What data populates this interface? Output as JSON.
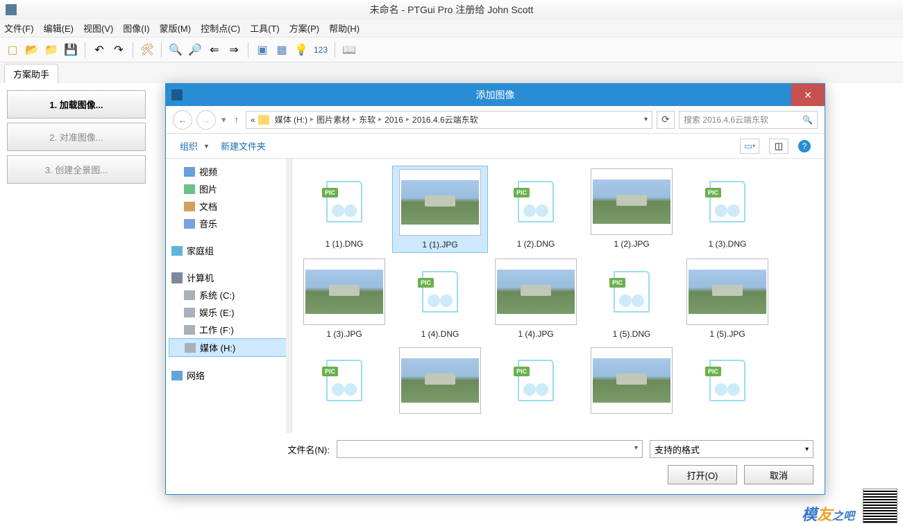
{
  "window": {
    "title": "未命名 - PTGui Pro 注册给 John Scott"
  },
  "menu": {
    "file": "文件(F)",
    "edit": "编辑(E)",
    "view": "视图(V)",
    "image": "图像(I)",
    "mask": "蒙版(M)",
    "ctrl": "控制点(C)",
    "tool": "工具(T)",
    "proj": "方案(P)",
    "help": "帮助(H)"
  },
  "toolbar": {
    "num": "123"
  },
  "tabs": {
    "wizard": "方案助手"
  },
  "wizard": {
    "b1": "1. 加载图像...",
    "b2": "2. 对准图像...",
    "b3": "3. 创建全景图..."
  },
  "dialog": {
    "title": "添加图像",
    "crumbs": {
      "pre": "«",
      "path1": "媒体 (H:)",
      "path2": "图片素材",
      "path3": "东软",
      "path4": "2016",
      "path5": "2016.4.6云端东软"
    },
    "search_placeholder": "搜索 2016.4.6云端东软",
    "organize": "组织",
    "newfolder": "新建文件夹",
    "tree": {
      "video": "视频",
      "pic": "图片",
      "doc": "文档",
      "music": "音乐",
      "homegroup": "家庭组",
      "computer": "计算机",
      "drvC": "系统 (C:)",
      "drvE": "娱乐 (E:)",
      "drvF": "工作 (F:)",
      "drvH": "媒体 (H:)",
      "network": "网络"
    },
    "files": [
      {
        "n": "1 (1).DNG",
        "t": "dng"
      },
      {
        "n": "1 (1).JPG",
        "t": "jpg",
        "sel": true
      },
      {
        "n": "1 (2).DNG",
        "t": "dng"
      },
      {
        "n": "1 (2).JPG",
        "t": "jpg"
      },
      {
        "n": "1 (3).DNG",
        "t": "dng"
      },
      {
        "n": "1 (3).JPG",
        "t": "jpg"
      },
      {
        "n": "1 (4).DNG",
        "t": "dng"
      },
      {
        "n": "1 (4).JPG",
        "t": "jpg"
      },
      {
        "n": "1 (5).DNG",
        "t": "dng"
      },
      {
        "n": "1 (5).JPG",
        "t": "jpg"
      },
      {
        "n": "",
        "t": "dng"
      },
      {
        "n": "",
        "t": "jpg"
      },
      {
        "n": "",
        "t": "dng"
      },
      {
        "n": "",
        "t": "jpg"
      },
      {
        "n": "",
        "t": "dng"
      }
    ],
    "pic_tag": "PIC",
    "filename_label": "文件名(N):",
    "format": "支持的格式",
    "open": "打开(O)",
    "cancel": "取消"
  },
  "logo": {
    "t1": "模",
    "t2": "友",
    "t3": "之吧"
  }
}
